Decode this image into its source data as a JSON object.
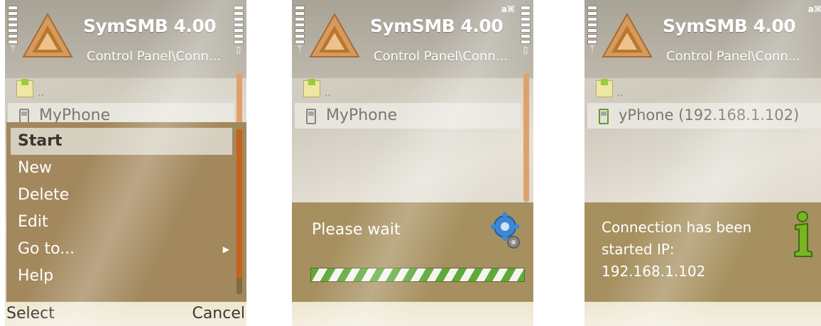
{
  "colors": {
    "menu_bg": "#a3885d",
    "header_bg": "#a8a397",
    "accent_scroll": "#c5631c",
    "progress_green": "#5fa93a",
    "info_icon": "#7ab521"
  },
  "screens": [
    {
      "app_title": "SymSMB 4.00",
      "subtitle": "Control Panel\\Conn...",
      "parent_folder": "..",
      "phone_item": "MyPhone",
      "menu": {
        "items": [
          {
            "label": "Start",
            "selected": true
          },
          {
            "label": "New"
          },
          {
            "label": "Delete"
          },
          {
            "label": "Edit"
          },
          {
            "label": "Go to...",
            "has_submenu": true
          },
          {
            "label": "Help"
          }
        ]
      },
      "softkeys": {
        "left": "Select",
        "right": "Cancel"
      }
    },
    {
      "app_title": "SymSMB 4.00",
      "subtitle": "Control Panel\\Conn...",
      "parent_folder": "..",
      "phone_item": "MyPhone",
      "dialog": {
        "text": "Please wait",
        "icon": "gear-icon"
      }
    },
    {
      "app_title": "SymSMB 4.00",
      "subtitle": "Control Panel\\Conn...",
      "parent_folder": "..",
      "phone_item": "yPhone (192.168.1.102)",
      "dialog": {
        "lines": [
          "Connection has been",
          "started IP:",
          "192.168.1.102"
        ],
        "icon": "info-icon"
      }
    }
  ]
}
